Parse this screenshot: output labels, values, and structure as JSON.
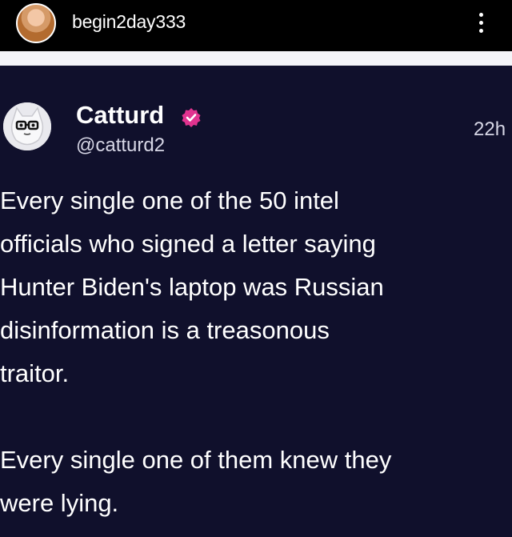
{
  "header": {
    "username": "begin2day333"
  },
  "post": {
    "author_name": "Catturd",
    "author_handle": "@catturd2",
    "timestamp": "22h",
    "paragraph_1": "Every single one of the 50 intel\nofficials who signed a letter saying\nHunter Biden's laptop was Russian\ndisinformation is a treasonous\ntraitor.",
    "paragraph_2": "Every single one of them knew they\nwere lying."
  },
  "colors": {
    "post_background": "#10102c",
    "verified_badge": "#e0338f"
  }
}
